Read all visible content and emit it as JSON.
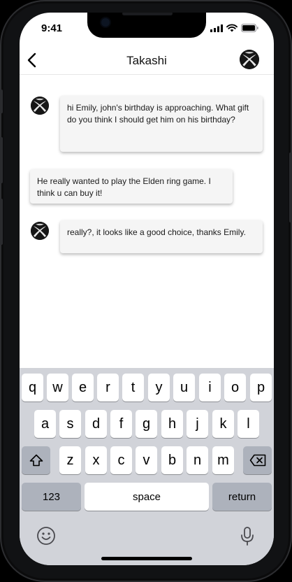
{
  "status": {
    "time": "9:41"
  },
  "header": {
    "title": "Takashi"
  },
  "messages": [
    {
      "side": "left-avatar",
      "text": "hi Emily, john's birthday is approaching. What gift do you think I should get him on his birthday?"
    },
    {
      "side": "no-avatar",
      "text": "He really wanted to play the Elden ring game. I think u can buy it!"
    },
    {
      "side": "left-avatar",
      "text": "really?, it looks like a good choice, thanks Emily."
    }
  ],
  "keyboard": {
    "row1": [
      "q",
      "w",
      "e",
      "r",
      "t",
      "y",
      "u",
      "i",
      "o",
      "p"
    ],
    "row2": [
      "a",
      "s",
      "d",
      "f",
      "g",
      "h",
      "j",
      "k",
      "l"
    ],
    "row3": [
      "z",
      "x",
      "c",
      "v",
      "b",
      "n",
      "m"
    ],
    "numbers_label": "123",
    "space_label": "space",
    "return_label": "return"
  },
  "icons": {
    "back": "chevron-left-icon",
    "shift": "shift-icon",
    "delete": "backspace-icon",
    "emoji": "emoji-icon",
    "mic": "microphone-icon",
    "avatar": "xbox-logo-icon"
  }
}
